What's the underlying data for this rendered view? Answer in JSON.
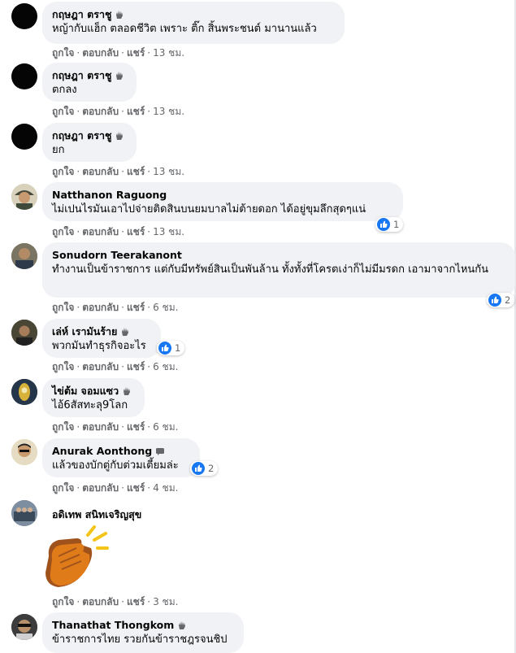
{
  "actions": {
    "like": "ถูกใจ",
    "reply": "ตอบกลับ",
    "share": "แชร์",
    "sep": "·"
  },
  "comments": [
    {
      "name": "กฤษฎา ตราชู",
      "text": "หญ้ากับแฮ็ก ตลอดชีวิต เพราะ ติ๊ก สิ้นพระชนต์ มานานแล้ว",
      "time": "13 ชม."
    },
    {
      "name": "กฤษฎา ตราชู",
      "text": "ตกลง",
      "time": "13 ชม."
    },
    {
      "name": "กฤษฎา ตราชู",
      "text": "ยก",
      "time": "13 ชม."
    },
    {
      "name": "Natthanon Raguong",
      "text": "ไม่เปนไรมันเอาไปจ่ายติดสินบนยมบาลไม่ต้ายดอก ได้อยู่ขุมลึกสุดๆแน่",
      "time": "13 ชม.",
      "reactions": "1"
    },
    {
      "name": "Sonudorn Teerakanont",
      "text": "ทำงานเป็นข้าราชการ แต่กับมีทรัพย์สินเป็นพันล้าน ทั้งทั้งที่โครตเง่าก็ไม่มีมรดก เอามาจากไหนกัน",
      "time": "6 ชม.",
      "reactions": "2"
    },
    {
      "name": "เล่ห์ เรามันร้าย",
      "text": "พวกมันทำธุรกิจอะไร",
      "time": "6 ชม.",
      "reactions": "1"
    },
    {
      "name": "ไข่ต้ม จอมแซว",
      "text": "ไอ้6สัสทะลุ9โลก",
      "time": "6 ชม."
    },
    {
      "name": "Anurak Aonthong",
      "text": "แล้วของบักตู่กับต่วมเตี้ยมล่ะ",
      "time": "4 ชม.",
      "reactions": "2"
    },
    {
      "name": "อดิเทพ สนิทเจริญสุข",
      "time": "3 ชม."
    },
    {
      "name": "Thanathat Thongkom",
      "text": "ข้าราชการไทย รวยกันข้าราชฎรจนชิป"
    }
  ],
  "colors": {
    "bubble": "#f0f2f5",
    "like_blue": "#1877f2",
    "meta_gray": "#65676b",
    "clap": "#e07b1a"
  }
}
